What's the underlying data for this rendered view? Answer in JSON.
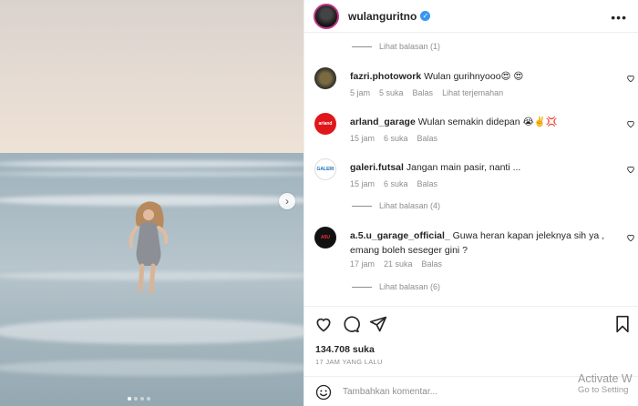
{
  "post": {
    "username": "wulanguritno",
    "verified_glyph": "✓",
    "more_glyph": "•••",
    "next_glyph": "›"
  },
  "comments": [
    {
      "avatar_text": "",
      "user": "fazri.photowork",
      "text": "Wulan gurihnyooo😍 😍",
      "time": "5 jam",
      "likes": "5 suka",
      "reply": "Balas",
      "translate": "Lihat terjemahan"
    },
    {
      "avatar_text": "arland",
      "user": "arland_garage",
      "text": "Wulan semakin didepan 😭✌️💢",
      "time": "15 jam",
      "likes": "6 suka",
      "reply": "Balas"
    },
    {
      "avatar_text": "GALERI",
      "user": "galeri.futsal",
      "text": "Jangan main pasir, nanti ...",
      "time": "15 jam",
      "likes": "6 suka",
      "reply": "Balas"
    },
    {
      "avatar_text": "A5U",
      "user": "a.5.u_garage_official_",
      "text": "Guwa heran kapan jeleknya sih ya , emang boleh seseger gini ?",
      "time": "17 jam",
      "likes": "21 suka",
      "reply": "Balas"
    }
  ],
  "replies": [
    "Lihat balasan (1)",
    "Lihat balasan (4)",
    "Lihat balasan (6)"
  ],
  "footer": {
    "likes": "134.708 suka",
    "time": "17 JAM YANG LALU",
    "comment_placeholder": "Tambahkan komentar..."
  },
  "watermark": {
    "line1": "Activate W",
    "line2": "Go to Setting"
  },
  "icons": [
    "more-icon",
    "verified-icon",
    "heart-icon",
    "comment-icon",
    "share-icon",
    "bookmark-icon",
    "emoji-icon",
    "chevron-right-icon"
  ]
}
